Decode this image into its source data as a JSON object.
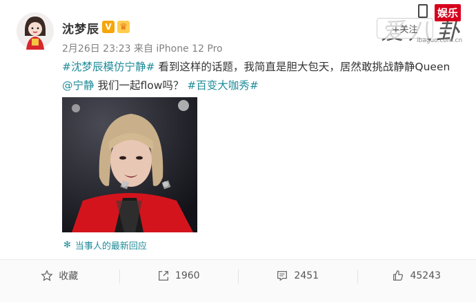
{
  "post": {
    "user_name": "沈梦辰",
    "verified_badge": "V",
    "meta": "2月26日 23:23 来自 iPhone 12 Pro",
    "follow_label": "+关注",
    "text": {
      "tag1": "#沈梦辰模仿宁静#",
      "part1": " 看到这样的话题，我简直是胆大包天，居然敢挑战静静Queen ",
      "mention": "@宁静",
      "part2": " 我们一起flow吗？ ",
      "tag2": "#百变大咖秀#"
    },
    "reply_link": "当事人的最新回应"
  },
  "watermark": {
    "tag": "娱乐",
    "logo": "爱八卦",
    "url": "ibaguo.com.cn"
  },
  "actions": {
    "favorite": "收藏",
    "repost_count": "1960",
    "comment_count": "2451",
    "like_count": "45243"
  },
  "colors": {
    "link": "#1f8b98",
    "verified": "#f6a50a",
    "watermark_red": "#d6001c"
  }
}
